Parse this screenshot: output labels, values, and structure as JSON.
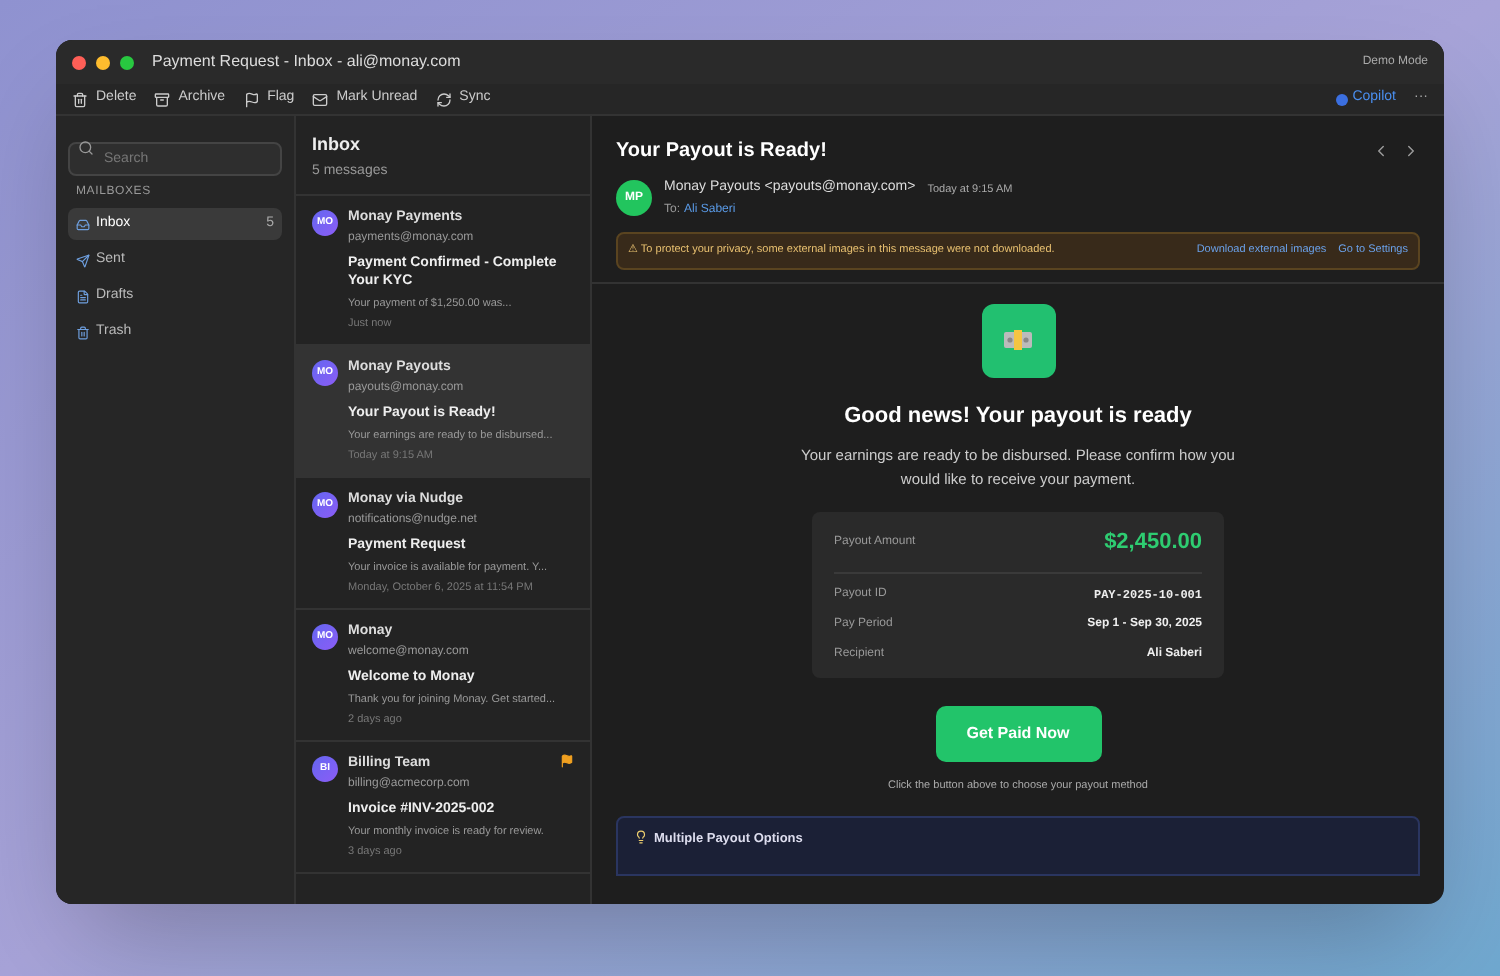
{
  "window": {
    "title": "Payment Request - Inbox - ali@monay.com",
    "mode": "Demo Mode"
  },
  "toolbar": [
    {
      "kind": "delete",
      "label": "Delete"
    },
    {
      "kind": "archive",
      "label": "Archive"
    },
    {
      "kind": "flag",
      "label": "Flag"
    },
    {
      "kind": "unread",
      "label": "Mark Unread"
    },
    {
      "kind": "sync",
      "label": "Sync"
    }
  ],
  "copilot": {
    "label": "Copilot",
    "more": "···"
  },
  "sidebar": {
    "search": {
      "placeholder": "Search"
    },
    "heading": "MAILBOXES",
    "items": [
      {
        "kind": "inbox",
        "label": "Inbox",
        "count": "5",
        "selected": true
      },
      {
        "kind": "sent",
        "label": "Sent",
        "selected": false
      },
      {
        "kind": "drafts",
        "label": "Drafts",
        "selected": false
      },
      {
        "kind": "trash",
        "label": "Trash",
        "selected": false
      }
    ]
  },
  "list": {
    "title": "Inbox",
    "subtitle": "5 messages",
    "messages": [
      {
        "initials": "MO",
        "sender": "Monay Payments",
        "email": "payments@monay.com",
        "subject": "Payment Confirmed - Complete Your KYC",
        "preview": "Your payment of $1,250.00 was...",
        "time": "Just now",
        "selected": false,
        "flagged": false
      },
      {
        "initials": "MO",
        "sender": "Monay Payouts",
        "email": "payouts@monay.com",
        "subject": "Your Payout is Ready!",
        "preview": "Your earnings are ready to be disbursed...",
        "time": "Today at 9:15 AM",
        "selected": true,
        "flagged": false
      },
      {
        "initials": "MO",
        "sender": "Monay via Nudge",
        "email": "notifications@nudge.net",
        "subject": "Payment Request",
        "preview": "Your invoice is available for payment. Y...",
        "time": "Monday, October 6, 2025 at 11:54 PM",
        "selected": false,
        "flagged": false
      },
      {
        "initials": "MO",
        "sender": "Monay",
        "email": "welcome@monay.com",
        "subject": "Welcome to Monay",
        "preview": "Thank you for joining Monay. Get started...",
        "time": "2 days ago",
        "selected": false,
        "flagged": false
      },
      {
        "initials": "BI",
        "sender": "Billing Team",
        "email": "billing@acmecorp.com",
        "subject": "Invoice #INV-2025-002",
        "preview": "Your monthly invoice is ready for review.",
        "time": "3 days ago",
        "selected": false,
        "flagged": true
      }
    ]
  },
  "message": {
    "subject": "Your Payout is Ready!",
    "initials": "MP",
    "from": "Monay Payouts",
    "from_email": "<payouts@monay.com>",
    "to_label": "To:",
    "to": "Ali Saberi",
    "time": "Today at 9:15 AM",
    "warning": {
      "text": "⚠ To protect your privacy, some external images in this message were not downloaded.",
      "links": [
        "Download external images",
        "Go to Settings"
      ]
    },
    "body": {
      "headline": "Good news! Your payout is ready",
      "intro": "Your earnings are ready to be disbursed. Please confirm how you would like to receive your payment.",
      "amount_label": "Payout Amount",
      "amount": "$2,450.00",
      "details": [
        {
          "label": "Payout ID",
          "value": "PAY-2025-10-001",
          "kind": "mono"
        },
        {
          "label": "Pay Period",
          "value": "Sep 1 - Sep 30, 2025",
          "kind": "text"
        },
        {
          "label": "Recipient",
          "value": "Ali Saberi",
          "kind": "text"
        }
      ],
      "button": "Get Paid Now",
      "hint": "Click the button above to choose your payout method",
      "tip_title": "Multiple Payout Options"
    }
  }
}
